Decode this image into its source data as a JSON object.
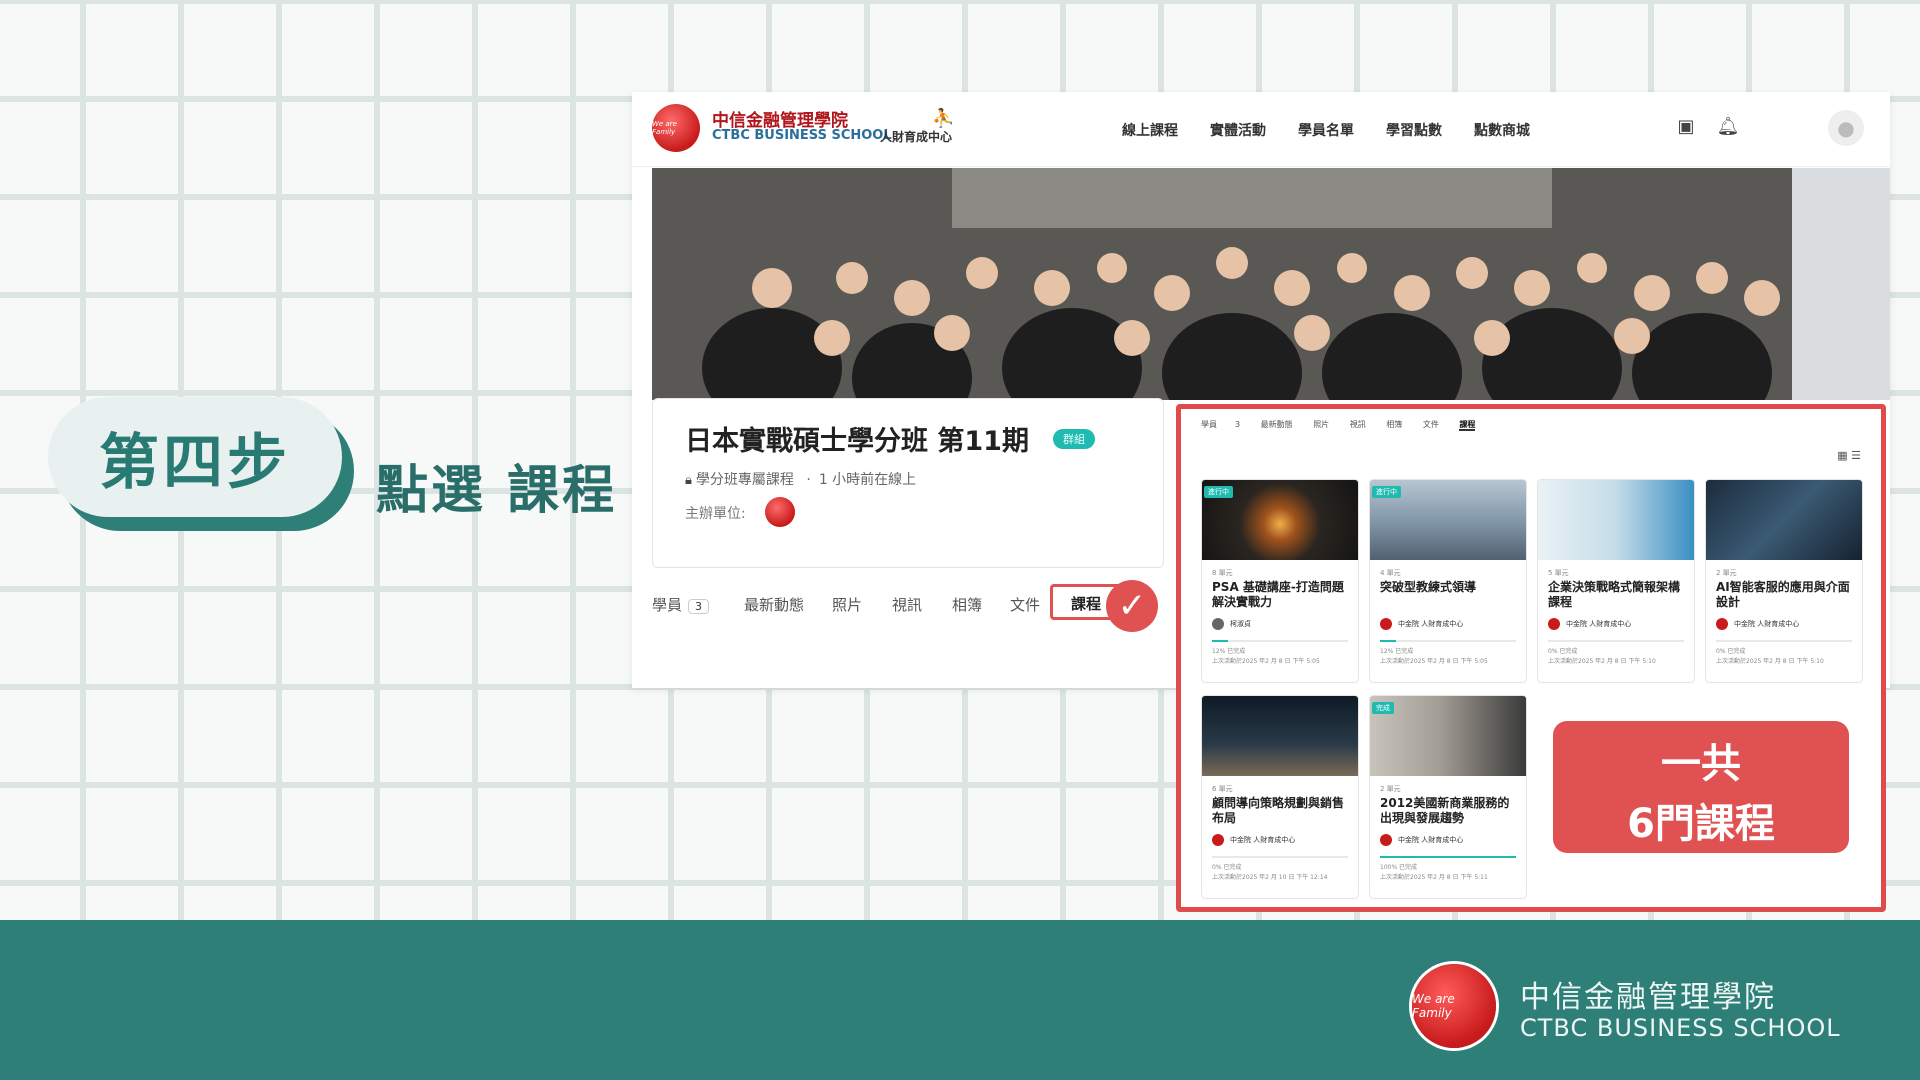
{
  "step": {
    "label": "第四步",
    "instruction": "點選 課程"
  },
  "site": {
    "name_cn": "中信金融管理學院",
    "name_en": "CTBC BUSINESS SCHOOL",
    "sub_unit": "人財育成中心",
    "logo_text": "We are Family",
    "nav": [
      "線上課程",
      "實體活動",
      "學員名單",
      "學習點數",
      "點數商城"
    ],
    "icons": [
      "inbox-icon",
      "bell-icon",
      "user-avatar-icon"
    ]
  },
  "group": {
    "title": "日本實戰碩士學分班 第11期",
    "badge": "群組",
    "subtitle": "學分班專屬課程",
    "online": "1 小時前在線上",
    "organizer_label": "主辦單位:",
    "tabs": [
      "學員",
      "最新動態",
      "照片",
      "視訊",
      "相簿",
      "文件",
      "課程"
    ],
    "member_count": "3",
    "active_tab": "課程"
  },
  "course_panel": {
    "tabs": [
      "學員",
      "3",
      "最新動態",
      "照片",
      "視訊",
      "相簿",
      "文件",
      "課程"
    ],
    "courses": [
      {
        "status": "進行中",
        "units": "8 單元",
        "title": "PSA 基礎講座-打造問題解決實戰力",
        "owner": "柯淑貞",
        "progress_label": "12% 已完成",
        "progress": 0.12,
        "last": "上次活動於2025 年2 月 8 日 下午 5:05"
      },
      {
        "status": "進行中",
        "units": "4 單元",
        "title": "突破型教練式領導",
        "owner": "中金院 人財育成中心",
        "progress_label": "12% 已完成",
        "progress": 0.12,
        "last": "上次活動於2025 年2 月 8 日 下午 5:05"
      },
      {
        "status": "",
        "units": "5 單元",
        "title": "企業決策戰略式簡報架構課程",
        "owner": "中金院 人財育成中心",
        "progress_label": "0% 已完成",
        "progress": 0,
        "last": "上次活動於2025 年2 月 8 日 下午 5:10"
      },
      {
        "status": "",
        "units": "2 單元",
        "title": "AI智能客服的應用與介面設計",
        "owner": "中金院 人財育成中心",
        "progress_label": "0% 已完成",
        "progress": 0,
        "last": "上次活動於2025 年2 月 8 日 下午 5:10"
      },
      {
        "status": "",
        "units": "6 單元",
        "title": "顧問導向策略規劃與銷售布局",
        "owner": "中金院 人財育成中心",
        "progress_label": "0% 已完成",
        "progress": 0,
        "last": "上次活動於2025 年2 月 10 日 下午 12:14"
      },
      {
        "status": "完成",
        "units": "2 單元",
        "title": "2012美國新商業服務的出現與發展趨勢",
        "owner": "中金院 人財育成中心",
        "progress_label": "100% 已完成",
        "progress": 1,
        "last": "上次活動於2025 年2 月 8 日 下午 5:11"
      }
    ],
    "total_line1": "一共",
    "total_line2": "6門課程"
  },
  "footer": {
    "name_cn": "中信金融管理學院",
    "name_en": "CTBC BUSINESS SCHOOL",
    "logo_text": "We are Family"
  },
  "colors": {
    "teal": "#2e7f78",
    "red": "#e05252",
    "accent": "#1fbab0"
  }
}
